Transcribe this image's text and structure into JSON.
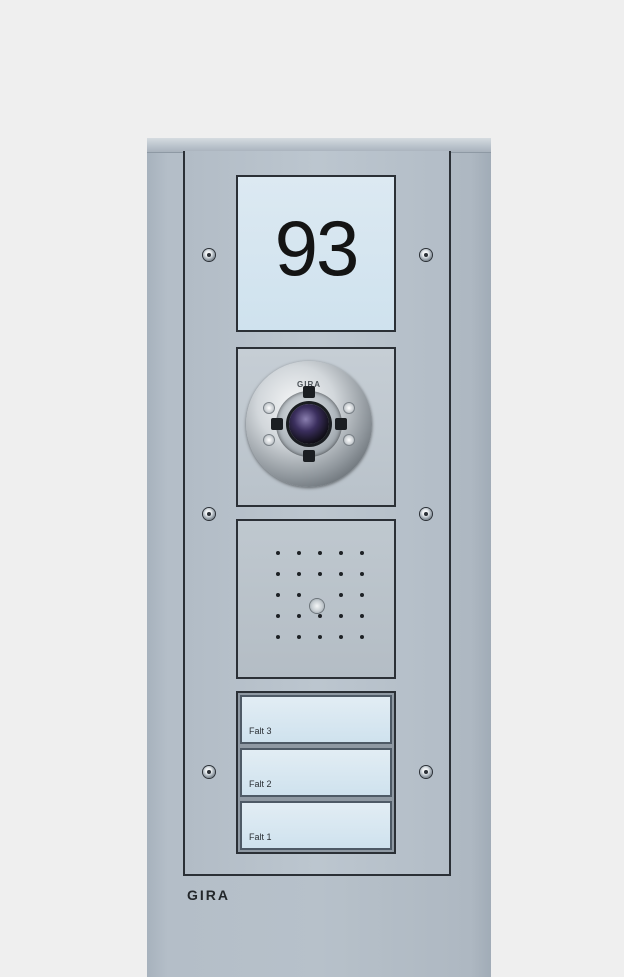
{
  "display": {
    "number": "93"
  },
  "camera": {
    "brand": "GIRA"
  },
  "doorbell": {
    "buttons": [
      {
        "label": "Falt 3"
      },
      {
        "label": "Falt 2"
      },
      {
        "label": "Falt 1"
      }
    ]
  },
  "panel": {
    "brand": "GIRA"
  },
  "colors": {
    "background": "#efefef",
    "panel": "#b7c1ca",
    "frame": "#2b3036",
    "display": "#cfe2ee"
  }
}
